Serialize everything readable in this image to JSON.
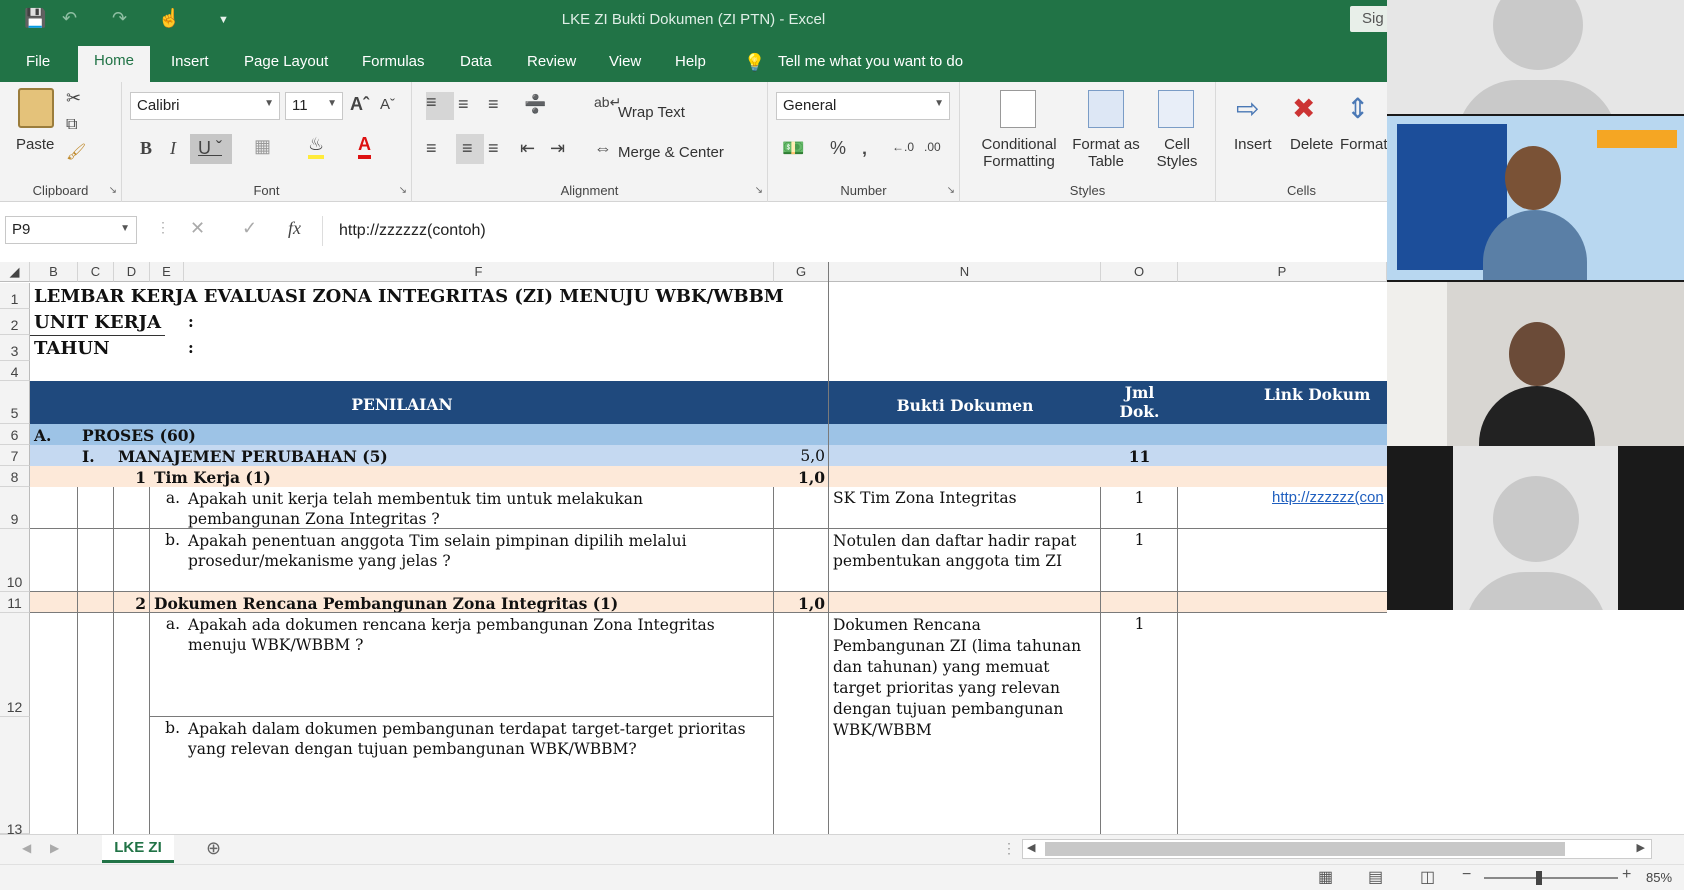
{
  "window": {
    "title": "LKE ZI Bukti Dokumen (ZI PTN)  -  Excel",
    "signin": "Sig"
  },
  "tabs": [
    "File",
    "Home",
    "Insert",
    "Page Layout",
    "Formulas",
    "Data",
    "Review",
    "View",
    "Help"
  ],
  "tell_me": "Tell me what you want to do",
  "ribbon": {
    "clipboard": {
      "label": "Clipboard",
      "paste": "Paste"
    },
    "font": {
      "label": "Font",
      "name": "Calibri",
      "size": "11"
    },
    "alignment": {
      "label": "Alignment",
      "wrap_text": "Wrap Text",
      "merge_center": "Merge & Center"
    },
    "number": {
      "label": "Number",
      "format": "General"
    },
    "styles": {
      "label": "Styles",
      "conditional": [
        "Conditional",
        "Formatting"
      ],
      "format_table": [
        "Format as",
        "Table"
      ],
      "cell_styles": [
        "Cell",
        "Styles"
      ]
    },
    "cells": {
      "label": "Cells",
      "insert": "Insert",
      "delete": "Delete",
      "format": "Format"
    }
  },
  "formula_bar": {
    "name_box": "P9",
    "value": "http://zzzzzz(contoh)"
  },
  "columns": [
    "B",
    "C",
    "D",
    "E",
    "F",
    "G",
    "N",
    "O",
    "P"
  ],
  "rows": [
    "1",
    "2",
    "3",
    "4",
    "5",
    "6",
    "7",
    "8",
    "9",
    "10",
    "11",
    "12",
    "13"
  ],
  "sheet": {
    "r1": "LEMBAR KERJA EVALUASI ZONA INTEGRITAS (ZI) MENUJU WBK/WBBM",
    "r2": "UNIT KERJA",
    "r3": "TAHUN",
    "colon": ":",
    "header_penilaian": "PENILAIAN",
    "header_bukti": "Bukti Dokumen",
    "header_jml": [
      "Jml",
      "Dok."
    ],
    "header_link": "Link Dokum",
    "r6_a": "A.",
    "r6_text": "PROSES (60)",
    "r7_num": "I.",
    "r7_text": "MANAJEMEN PERUBAHAN (5)",
    "r7_g": "5,0",
    "r7_o": "11",
    "r8_num": "1",
    "r8_text": "Tim Kerja (1)",
    "r8_g": "1,0",
    "r9_letter": "a.",
    "r9_text": [
      "Apakah unit kerja telah membentuk tim untuk melakukan",
      "pembangunan Zona Integritas ?"
    ],
    "r9_n": "SK Tim Zona Integritas",
    "r9_o": "1",
    "r9_p": "http://zzzzzz(con",
    "r10_letter": "b.",
    "r10_text": [
      "Apakah penentuan anggota Tim selain pimpinan dipilih melalui",
      "prosedur/mekanisme yang jelas ?"
    ],
    "r10_n": [
      "Notulen dan daftar hadir rapat",
      "pembentukan anggota tim ZI"
    ],
    "r10_o": "1",
    "r11_num": "2",
    "r11_text": "Dokumen Rencana Pembangunan Zona Integritas (1)",
    "r11_g": "1,0",
    "r12_letter": "a.",
    "r12_text": [
      "Apakah ada dokumen rencana kerja pembangunan Zona Integritas",
      "menuju WBK/WBBM ?"
    ],
    "r12_n": [
      "Dokumen Rencana",
      "Pembangunan ZI (lima tahunan",
      "dan tahunan) yang memuat",
      "target prioritas yang relevan",
      "dengan tujuan pembangunan",
      "WBK/WBBM"
    ],
    "r12_o": "1",
    "r13_letter": "b.",
    "r13_text": [
      "Apakah dalam dokumen pembangunan terdapat target-target prioritas",
      "yang relevan dengan tujuan pembangunan WBK/WBBM?"
    ]
  },
  "sheet_tab": "LKE ZI",
  "status": {
    "zoom": "85%"
  },
  "colors": {
    "excel_green": "#217346",
    "header_blue": "#1f497d",
    "light_blue": "#9dc3e6",
    "pale_blue": "#c5d9f1",
    "peach": "#fde9d9"
  }
}
